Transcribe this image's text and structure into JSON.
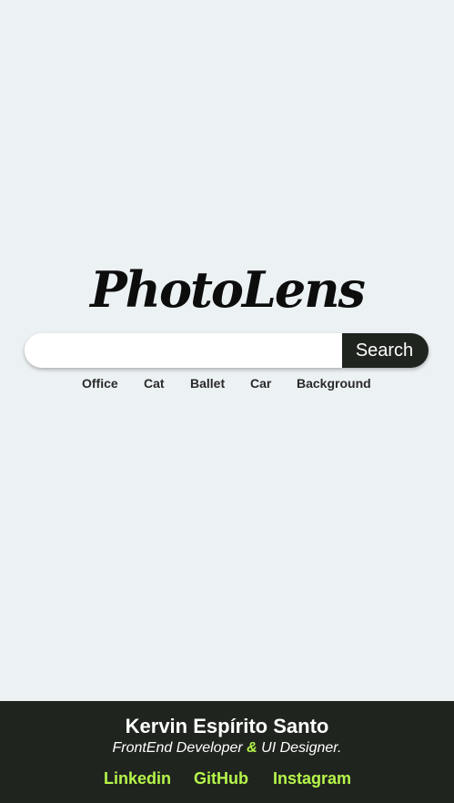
{
  "logo": {
    "text": "PhotoLens"
  },
  "search": {
    "value": "",
    "placeholder": "",
    "button_label": "Search"
  },
  "suggestions": [
    "Office",
    "Cat",
    "Ballet",
    "Car",
    "Background"
  ],
  "footer": {
    "name": "Kervin Espírito Santo",
    "role_part1": "FrontEnd Developer ",
    "role_amp": "&",
    "role_part2": " UI Designer.",
    "links": [
      "Linkedin",
      "GitHub",
      "Instagram"
    ]
  },
  "colors": {
    "background": "#ecf1f4",
    "dark": "#20241f",
    "accent": "#b5f54a"
  }
}
